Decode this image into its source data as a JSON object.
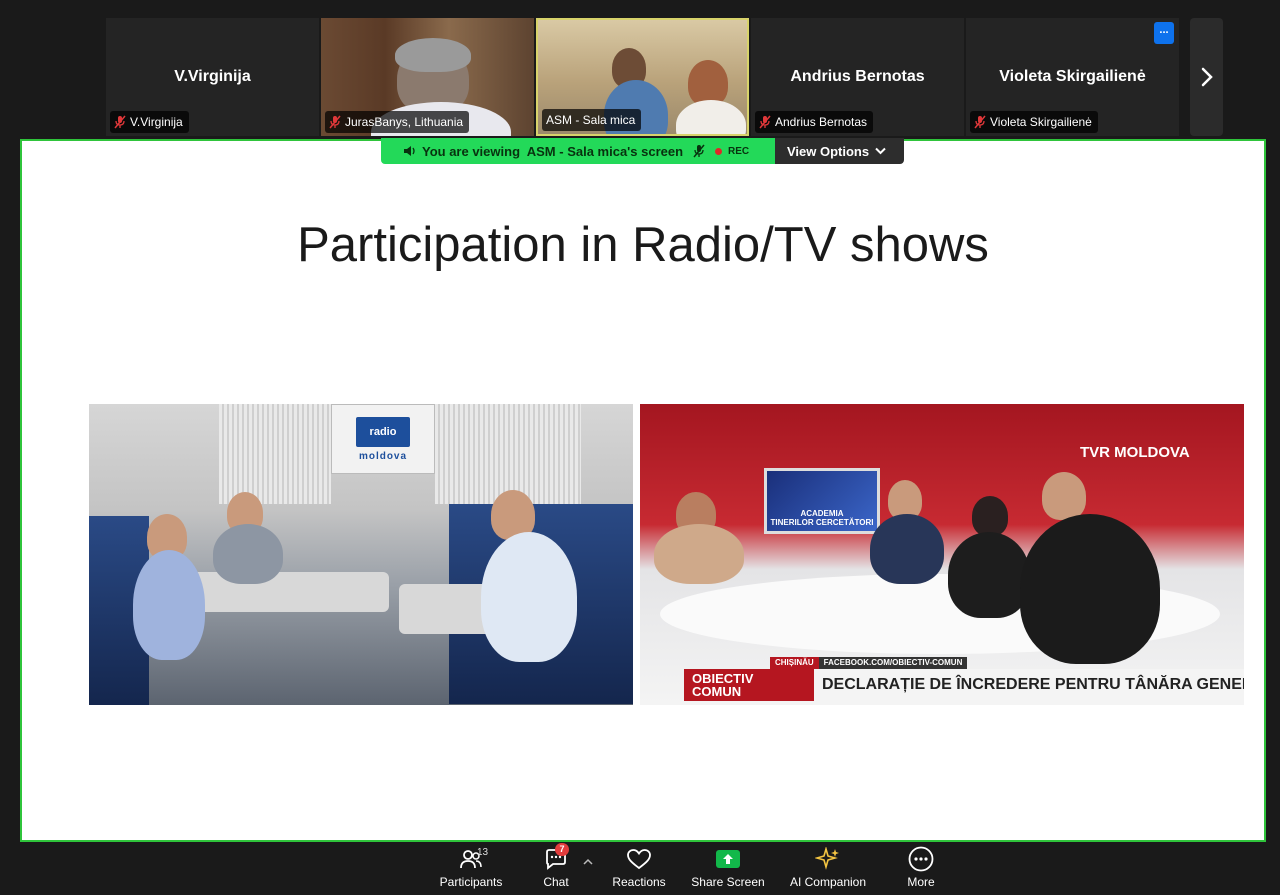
{
  "participants": [
    {
      "name": "V.Virginija",
      "label": "V.Virginija",
      "video": false,
      "muted": true
    },
    {
      "name": "JurasBanys, Lithuania",
      "label": "JurasBanys, Lithuania",
      "video": true,
      "muted": true
    },
    {
      "name": "ASM - Sala mica",
      "label": "ASM - Sala mica",
      "video": true,
      "muted": false,
      "active_speaker": true
    },
    {
      "name": "Andrius Bernotas",
      "label": "Andrius Bernotas",
      "video": false,
      "muted": true
    },
    {
      "name": "Violeta Skirgailienė",
      "label": "Violeta Skirgailienė",
      "video": false,
      "muted": true
    }
  ],
  "strip": {
    "overflow_badge": "..."
  },
  "share_banner": {
    "text": "You are viewing  ASM - Sala mica's screen",
    "rec": "REC",
    "view_options": "View Options"
  },
  "slide": {
    "title": "Participation in Radio/TV shows",
    "radio_photo": {
      "sign_text": "moldova",
      "sign_mark": "radio"
    },
    "tv_photo": {
      "channel_logo": "TVR MOLDOVA",
      "screen_text_1": "ACADEMIA",
      "screen_text_2": "TINERILOR CERCETĂTORI",
      "location": "CHIȘINĂU",
      "url": "FACEBOOK.COM/OBIECTIV-COMUN",
      "show_line_1": "OBIECTIV",
      "show_line_2": "COMUN",
      "headline": "DECLARAȚIE DE ÎNCREDERE PENTRU TÂNĂRA GENERAȚIE"
    }
  },
  "toolbar": {
    "participants": {
      "label": "Participants",
      "count": "13"
    },
    "chat": {
      "label": "Chat",
      "badge": "7"
    },
    "reactions": {
      "label": "Reactions"
    },
    "share_screen": {
      "label": "Share Screen"
    },
    "ai_companion": {
      "label": "AI Companion"
    },
    "more": {
      "label": "More"
    }
  },
  "colors": {
    "share_green": "#23d959",
    "share_border": "#2fc43b",
    "muted_red": "#e0383a",
    "share_screen_green": "#12b84a",
    "ai_gold": "#f4c542"
  }
}
